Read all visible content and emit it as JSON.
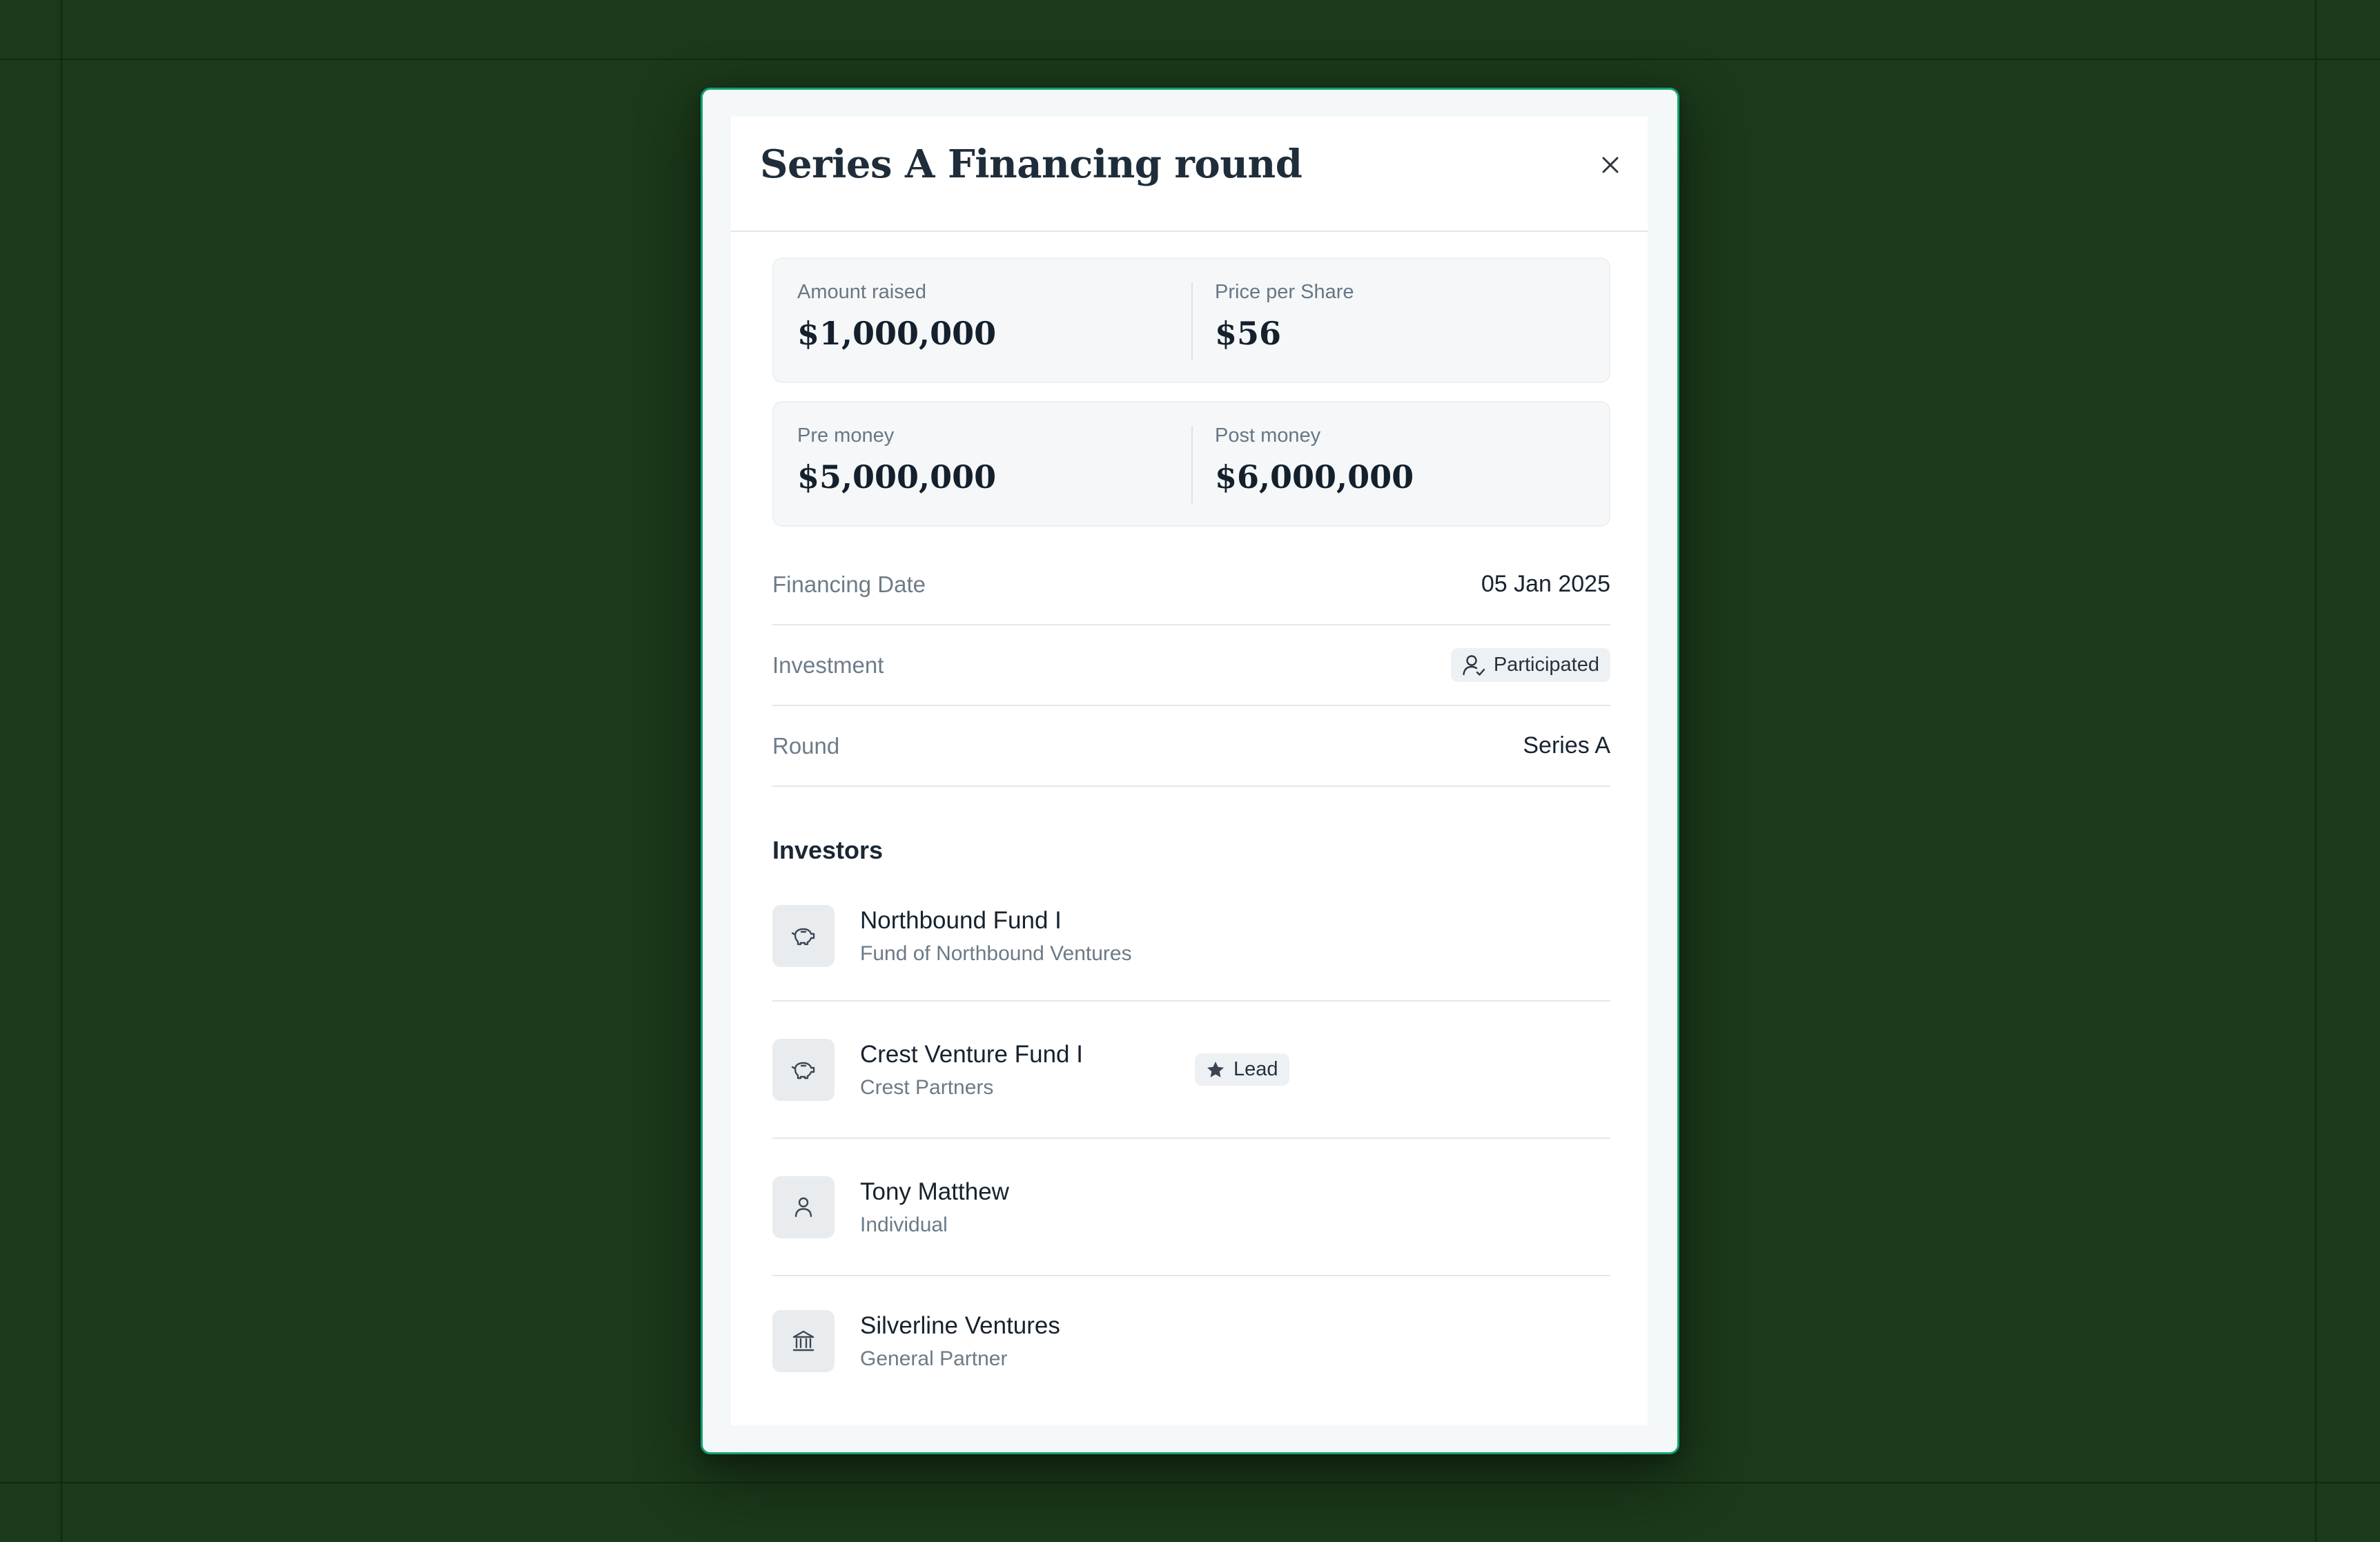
{
  "modal": {
    "title": "Series A Financing round",
    "close_label": "Close"
  },
  "stats": [
    [
      {
        "label": "Amount raised",
        "value": "$1,000,000"
      },
      {
        "label": "Price per Share",
        "value": "$56"
      }
    ],
    [
      {
        "label": "Pre money",
        "value": "$5,000,000"
      },
      {
        "label": "Post money",
        "value": "$6,000,000"
      }
    ]
  ],
  "details": {
    "financing_date": {
      "label": "Financing Date",
      "value": "05 Jan 2025"
    },
    "investment": {
      "label": "Investment",
      "badge": "Participated",
      "icon": "user-check-icon"
    },
    "round": {
      "label": "Round",
      "value": "Series A"
    }
  },
  "investors_title": "Investors",
  "investors": [
    {
      "name": "Northbound Fund I",
      "subtitle": "Fund of Northbound Ventures",
      "icon": "piggy-bank-icon"
    },
    {
      "name": "Crest Venture Fund I",
      "subtitle": "Crest Partners",
      "icon": "piggy-bank-icon",
      "badge": "Lead"
    },
    {
      "name": "Tony Matthew",
      "subtitle": "Individual",
      "icon": "user-icon"
    },
    {
      "name": "Silverline Ventures",
      "subtitle": "General Partner",
      "icon": "bank-icon"
    }
  ],
  "colors": {
    "background": "#1b391b",
    "accent_border": "#12a06e",
    "text_primary": "#16222d",
    "text_muted": "#6c7a86"
  }
}
